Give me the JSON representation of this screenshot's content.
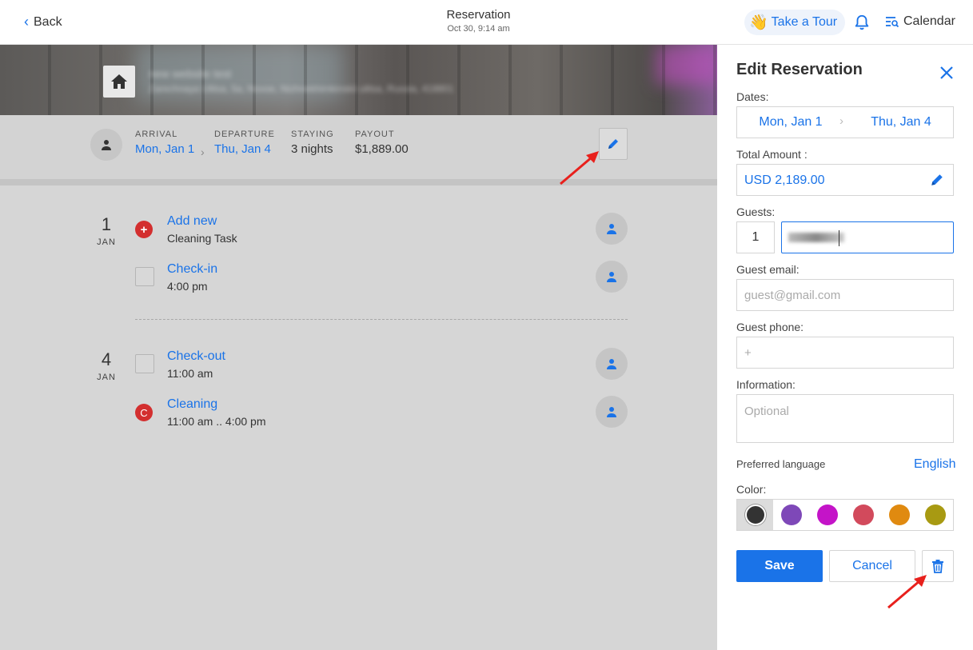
{
  "header": {
    "back_label": "Back",
    "title": "Reservation",
    "subtitle": "Oct 30, 9:14 am",
    "tour_label": "Take a Tour",
    "tour_emoji": "👋",
    "calendar_label": "Calendar"
  },
  "hero": {
    "property_name": "new website test",
    "property_address": "Zarechnaya Ulitsa, 5a, Novoe, Nizhnekhimkinskii ulitsa, Russia, 418801"
  },
  "summary": {
    "arrival_label": "ARRIVAL",
    "arrival_value": "Mon, Jan 1",
    "departure_label": "DEPARTURE",
    "departure_value": "Thu, Jan 4",
    "staying_label": "STAYING",
    "staying_value": "3 nights",
    "payout_label": "PAYOUT",
    "payout_value": "$1,889.00",
    "separator": "›"
  },
  "days": [
    {
      "day": "1",
      "month": "JAN",
      "tasks": [
        {
          "title": "Add new",
          "subtitle": "Cleaning Task",
          "icon": "plus"
        },
        {
          "title": "Check-in",
          "subtitle": "4:00 pm",
          "icon": "checkbox"
        }
      ]
    },
    {
      "day": "4",
      "month": "JAN",
      "tasks": [
        {
          "title": "Check-out",
          "subtitle": "11:00 am",
          "icon": "checkbox"
        },
        {
          "title": "Cleaning",
          "subtitle": "11:00 am .. 4:00 pm",
          "icon": "C"
        }
      ]
    }
  ],
  "panel": {
    "title": "Edit Reservation",
    "dates_label": "Dates:",
    "date_from": "Mon, Jan 1",
    "date_sep": "›",
    "date_to": "Thu, Jan 4",
    "total_label": "Total Amount :",
    "total_value": "USD 2,189.00",
    "guests_label": "Guests:",
    "guests_count": "1",
    "email_label": "Guest email:",
    "email_placeholder": "guest@gmail.com",
    "phone_label": "Guest phone:",
    "phone_placeholder": "+",
    "info_label": "Information:",
    "info_placeholder": "Optional",
    "language_label": "Preferred language",
    "language_value": "English",
    "color_label": "Color:",
    "colors": [
      "#333333",
      "#7e48b8",
      "#c414c8",
      "#d24a5c",
      "#e08a10",
      "#a89a12"
    ],
    "selected_color_index": 0,
    "save_label": "Save",
    "cancel_label": "Cancel"
  },
  "accent_color": "#1a73e8",
  "icons": [
    "chevron-left-icon",
    "bell-icon",
    "calendar-search-icon",
    "home-icon",
    "person-icon",
    "pencil-icon",
    "plus-icon",
    "close-icon",
    "trash-icon",
    "red-arrow"
  ]
}
